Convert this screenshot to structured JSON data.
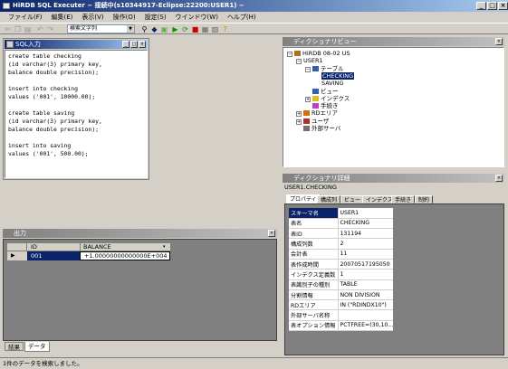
{
  "window": {
    "title": "HiRDB SQL Executer  − 接続中(s10344917-Eclipse:22200:USER1) −"
  },
  "menu": [
    "ファイル(F)",
    "編集(E)",
    "表示(V)",
    "操作(O)",
    "設定(S)",
    "ウインドウ(W)",
    "ヘルプ(H)"
  ],
  "toolbar": {
    "search_placeholder": "検索文字列"
  },
  "sql_panel": {
    "title": "SQL入力",
    "lines": [
      "create table checking",
      "(id varchar(3) primary key,",
      "balance double precision);",
      "",
      "insert into checking",
      "values ('001', 10000.00);",
      "",
      "create table saving",
      "(id varchar(3) primary key,",
      "balance double precision);",
      "",
      "insert into saving",
      "values ('001', 500.00);"
    ]
  },
  "dictionary": {
    "title": "ディクショナリビュー",
    "nodes": [
      {
        "label": "HiRDB 08-02   US",
        "level": 0,
        "expander": "−",
        "icon": "database-icon"
      },
      {
        "label": "USER1",
        "level": 1,
        "expander": "−",
        "icon": ""
      },
      {
        "label": "テーブル",
        "level": 2,
        "expander": "−",
        "icon": "table-folder-icon"
      },
      {
        "label": "CHECKING",
        "level": 3,
        "expander": "",
        "icon": "",
        "selected": true
      },
      {
        "label": "SAVING",
        "level": 3,
        "expander": "",
        "icon": ""
      },
      {
        "label": "ビュー",
        "level": 2,
        "expander": "",
        "icon": "view-icon"
      },
      {
        "label": "インデクス",
        "level": 2,
        "expander": "+",
        "icon": "index-icon"
      },
      {
        "label": "手続き",
        "level": 2,
        "expander": "",
        "icon": "procedure-icon"
      },
      {
        "label": "RDエリア",
        "level": 1,
        "expander": "+",
        "icon": "rdarea-icon"
      },
      {
        "label": "ユーザ",
        "level": 1,
        "expander": "+",
        "icon": "user-icon"
      },
      {
        "label": "外部サーバ",
        "level": 1,
        "expander": "",
        "icon": "server-icon"
      }
    ]
  },
  "detail": {
    "title": "ディクショナリ詳細",
    "path": "USER1.CHECKING",
    "tabs": [
      "プロパティ",
      "構成列",
      "ビュー",
      "インデクス",
      "手続き",
      "制約"
    ],
    "rows": [
      {
        "k": "スキーマ名",
        "v": "USER1"
      },
      {
        "k": "表名",
        "v": "CHECKING"
      },
      {
        "k": "表ID",
        "v": "131194"
      },
      {
        "k": "構成列数",
        "v": "2"
      },
      {
        "k": "会計表",
        "v": "11"
      },
      {
        "k": "表作成時間",
        "v": "20070517195050"
      },
      {
        "k": "インデクス定義数",
        "v": "1"
      },
      {
        "k": "表識別子の種別",
        "v": "TABLE"
      },
      {
        "k": "分割情報",
        "v": "NON DIVISION"
      },
      {
        "k": "RDエリア",
        "v": "IN (\"RDINDX10\")"
      },
      {
        "k": "外部サーバ名称",
        "v": ""
      },
      {
        "k": "表オプション情報",
        "v": "PCTFREE=(30,10..."
      }
    ]
  },
  "output": {
    "title": "出力",
    "columns": [
      "ID",
      "BALANCE"
    ],
    "rows": [
      {
        "id": "001",
        "balance": "+1.00000000000000E+004"
      }
    ],
    "tabs": [
      "結果",
      "データ"
    ]
  },
  "status": "1件のデータを検索しました。"
}
